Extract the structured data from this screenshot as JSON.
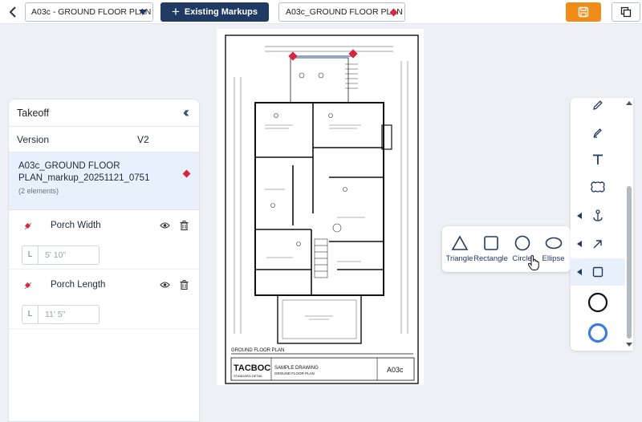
{
  "topbar": {
    "document_select": "A03c - GROUND FLOOR PLAN",
    "existing_markups_label": "Existing Markups",
    "markup_tab": "A03c_GROUND FLOOR PLAN"
  },
  "takeoff": {
    "title": "Takeoff",
    "version_label": "Version",
    "version_value": "V2",
    "markup": {
      "name": "A03c_GROUND FLOOR PLAN_markup_20251121_0751",
      "count": "(2 elements)"
    },
    "items": [
      {
        "label": "Porch Width",
        "length_unit": "L",
        "length_value": "5' 10\""
      },
      {
        "label": "Porch Length",
        "length_unit": "L",
        "length_value": "11' 5\""
      }
    ]
  },
  "shapes": {
    "options": [
      {
        "label": "Triangle",
        "icon": "triangle-icon"
      },
      {
        "label": "Rectangle",
        "icon": "square-icon"
      },
      {
        "label": "Circle",
        "icon": "circle-icon"
      },
      {
        "label": "Ellipse",
        "icon": "ellipse-icon"
      }
    ]
  },
  "drawing": {
    "title": "GROUND FLOOR PLAN",
    "company": "TACBOC",
    "company_sub": "STANDARD DETAIL",
    "sheet_name": "SAMPLE DRAWING",
    "sheet_sub": "GROUND FLOOR PLAN",
    "sheet_no": "A03c"
  },
  "colors": {
    "navy": "#1f3b63",
    "accent_orange": "#f28c18",
    "marker_red": "#d7263d",
    "selection_blue": "#3b7dd8"
  },
  "toolbar": {
    "tools": [
      "pencil-icon",
      "highlighter-icon",
      "text-icon",
      "cloud-icon",
      "anchor-icon",
      "arrow-icon",
      "shape-icon",
      "circle-black-icon",
      "circle-blue-icon"
    ]
  }
}
